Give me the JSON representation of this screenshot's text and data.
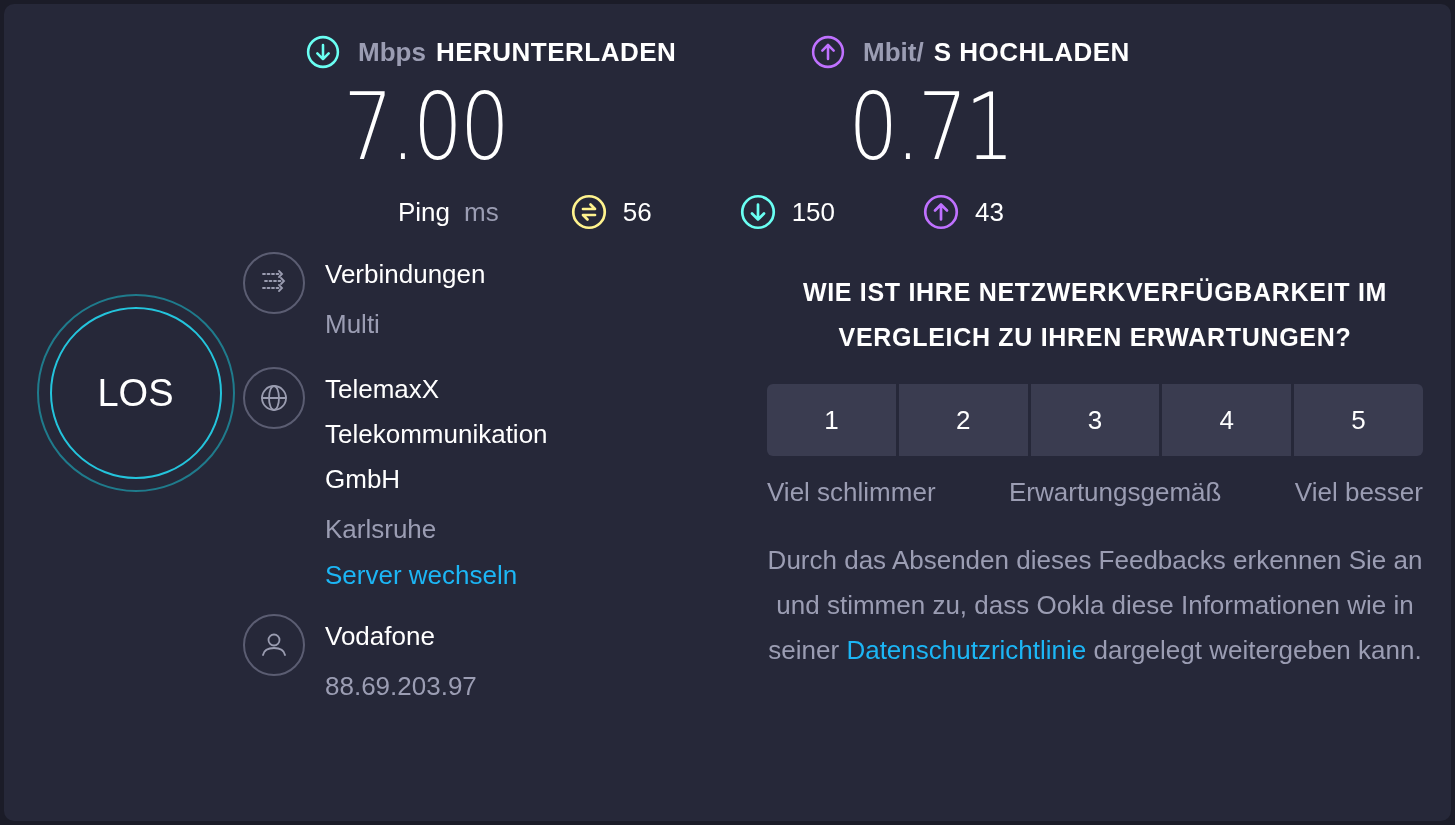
{
  "download": {
    "kind": "download",
    "unit": "Mbps",
    "label": "HERUNTERLADEN",
    "value": "7.00"
  },
  "upload": {
    "kind": "upload",
    "unit": "Mbit/",
    "label": "S HOCHLADEN",
    "value": "0.71"
  },
  "ping": {
    "label": "Ping",
    "unit": "ms",
    "items": [
      {
        "kind": "ping",
        "value": "56"
      },
      {
        "kind": "download",
        "value": "150"
      },
      {
        "kind": "upload",
        "value": "43"
      }
    ]
  },
  "go_button": "LOS",
  "info": [
    {
      "kind": "connections",
      "lines": [
        "Verbindungen"
      ],
      "detail": "Multi"
    },
    {
      "kind": "server",
      "lines": [
        "TelemaxX",
        "Telekommunikation",
        "GmbH"
      ],
      "detail": "Karlsruhe",
      "link": "Server wechseln"
    },
    {
      "kind": "provider",
      "lines": [
        "Vodafone"
      ],
      "detail": "88.69.203.97"
    }
  ],
  "feedback": {
    "question": "WIE IST IHRE NETZWERKVERFÜGBARKEIT IM VERGLEICH ZU IHREN ERWARTUNGEN?",
    "options": [
      {
        "label": "1",
        "selected": false
      },
      {
        "label": "2",
        "selected": false
      },
      {
        "label": "3",
        "selected": false
      },
      {
        "label": "4",
        "selected": false
      },
      {
        "label": "5",
        "selected": false
      }
    ],
    "scale_labels": [
      "Viel schlimmer",
      "Erwartungsgemäß",
      "Viel besser"
    ],
    "disclaimer_before": "Durch das Absenden dieses Feedbacks erkennen Sie an und stimmen zu, dass Ookla diese Informationen wie in seiner",
    "disclaimer_link": "Datenschutzrichtlinie",
    "disclaimer_after": "dargelegt weitergeben kann."
  }
}
